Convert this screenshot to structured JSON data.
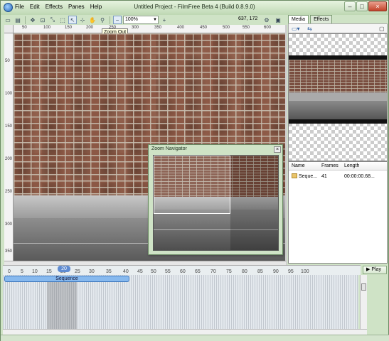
{
  "window": {
    "title": "Untitled Project - FilmFree Beta 4 (Build 0.8.9.0)",
    "minimize": "–",
    "maximize": "□",
    "close": "×"
  },
  "menu": [
    "File",
    "Edit",
    "Effects",
    "Panes",
    "Help"
  ],
  "toolbar": {
    "zoom_value": "100%",
    "zoom_out_tooltip": "Zoom Out",
    "coords": "637, 172"
  },
  "ruler": {
    "h_labels": [
      "50",
      "100",
      "150",
      "200",
      "250",
      "300",
      "350",
      "400",
      "450",
      "500",
      "550",
      "600"
    ],
    "v_labels": [
      "50",
      "100",
      "150",
      "200",
      "250",
      "300",
      "350"
    ]
  },
  "navigator": {
    "title": "Zoom Navigator",
    "close": "×"
  },
  "panes": {
    "tabs": [
      "Media",
      "Effects"
    ],
    "columns": [
      "Name",
      "Frames",
      "Length"
    ],
    "rows": [
      {
        "name": "Seque...",
        "frames": "41",
        "length": "00:00:00.68..."
      }
    ]
  },
  "timeline": {
    "labels": [
      "0",
      "5",
      "10",
      "15",
      "20",
      "25",
      "30",
      "35",
      "40",
      "45",
      "50",
      "55",
      "60",
      "65",
      "70",
      "75",
      "80",
      "85",
      "90",
      "95",
      "100"
    ],
    "marker": "20",
    "clip_label": "Sequence",
    "play_label": "Play"
  }
}
